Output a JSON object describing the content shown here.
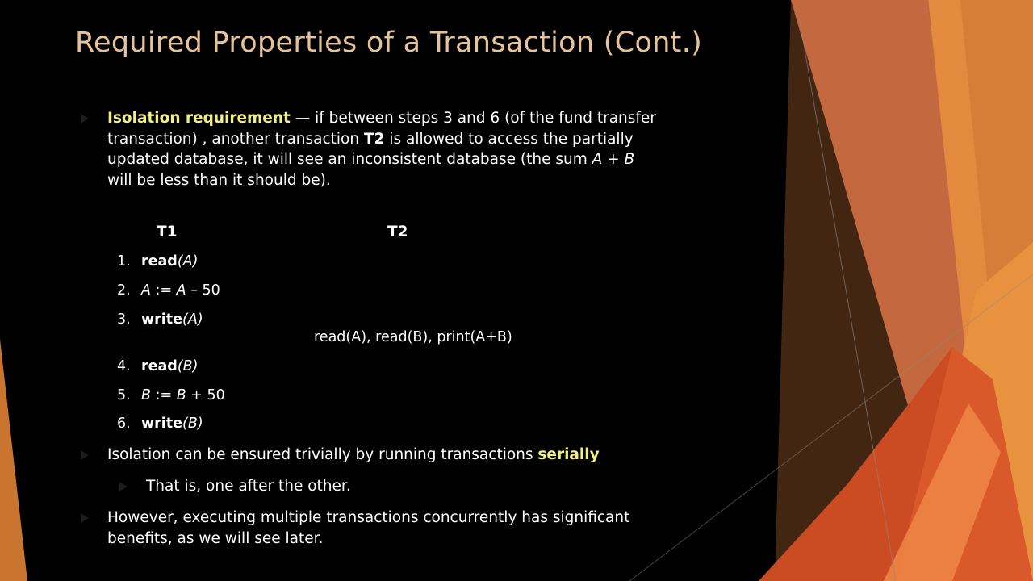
{
  "slide": {
    "title": "Required Properties of a Transaction (Cont.)",
    "colors": {
      "title": "#e6c298",
      "highlight": "#f3ef86",
      "background": "#000000",
      "accent_orange": "#e08a3a"
    }
  },
  "bullet1": {
    "term": "Isolation requirement",
    "line1_rest": " — if between steps 3 and 6 (of the fund transfer",
    "line2_a": "transaction) , another transaction ",
    "line2_t2": "T2",
    "line2_b": " is allowed to access the partially",
    "line3_a": "updated database, it will see an inconsistent database (the sum ",
    "line3_formula": "A + B",
    "line4": "will be less than it should be)."
  },
  "schedule": {
    "t1_header": "T1",
    "t2_header": "T2",
    "steps": [
      {
        "num": "1.",
        "op": "read",
        "arg": "(A)"
      },
      {
        "num": "2.",
        "lhs": "A",
        "mid": " := ",
        "rhs": "A",
        "rest": " – 50"
      },
      {
        "num": "3.",
        "op": "write",
        "arg": "(A)"
      },
      {
        "num": "4.",
        "op": "read",
        "arg": "(B)"
      },
      {
        "num": "5.",
        "lhs": "B",
        "mid": " := ",
        "rhs": "B",
        "rest": " + 50"
      },
      {
        "num": "6.",
        "op": "write",
        "arg": "(B)"
      }
    ],
    "t2_ops": "read(A), read(B), print(A+B)"
  },
  "bullet2": {
    "text": "Isolation can be ensured trivially by running transactions ",
    "highlight": "serially"
  },
  "bullet2_sub": {
    "text": "That is, one after the other."
  },
  "bullet3": {
    "line1": "However, executing multiple transactions concurrently has significant",
    "line2": "benefits, as we will see later."
  }
}
